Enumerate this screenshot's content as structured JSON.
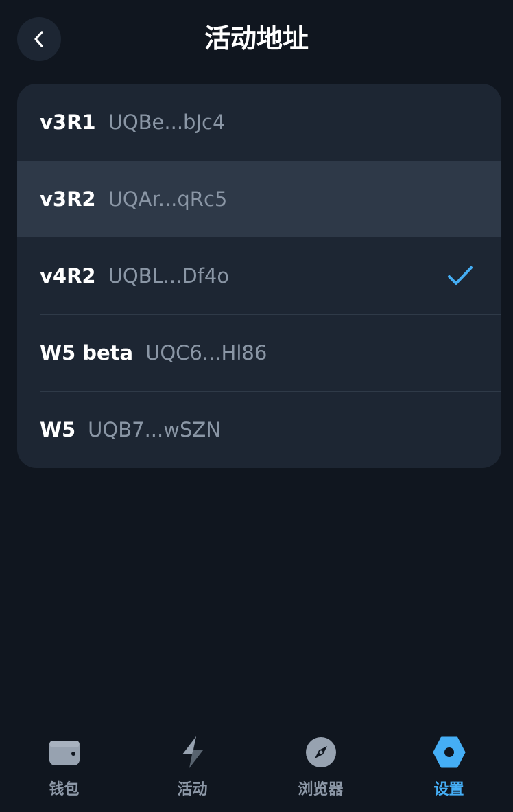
{
  "header": {
    "title": "活动地址"
  },
  "addresses": [
    {
      "version": "v3R1",
      "address": "UQBe...bJc4",
      "highlighted": false,
      "selected": false
    },
    {
      "version": "v3R2",
      "address": "UQAr...qRc5",
      "highlighted": true,
      "selected": false
    },
    {
      "version": "v4R2",
      "address": "UQBL...Df4o",
      "highlighted": false,
      "selected": true
    },
    {
      "version": "W5 beta",
      "address": "UQC6...Hl86",
      "highlighted": false,
      "selected": false
    },
    {
      "version": "W5",
      "address": "UQB7...wSZN",
      "highlighted": false,
      "selected": false
    }
  ],
  "tabbar": {
    "tabs": [
      {
        "label": "钱包",
        "icon": "wallet-icon",
        "active": false
      },
      {
        "label": "活动",
        "icon": "lightning-icon",
        "active": false
      },
      {
        "label": "浏览器",
        "icon": "compass-icon",
        "active": false
      },
      {
        "label": "设置",
        "icon": "settings-icon",
        "active": true
      }
    ]
  },
  "colors": {
    "background": "#10161f",
    "card": "#1d2633",
    "highlight_row": "#2e3948",
    "accent": "#45aef5",
    "muted_text": "#8a96a5"
  }
}
